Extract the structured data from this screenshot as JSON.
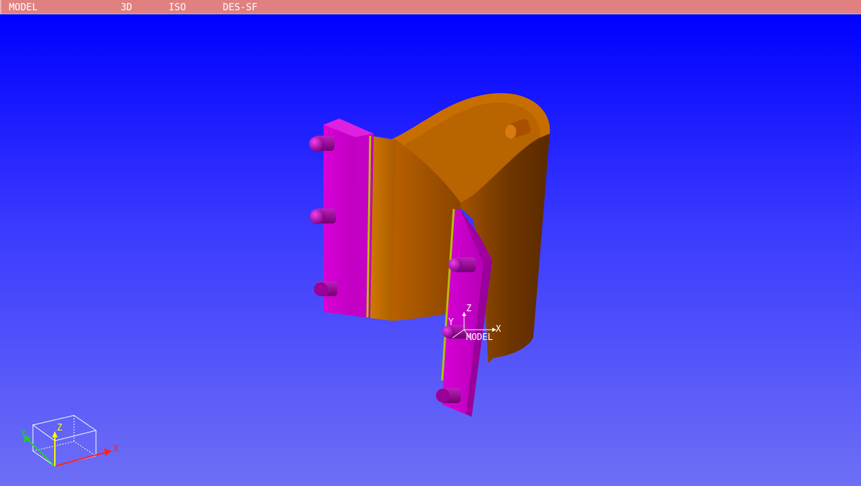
{
  "status_bar": {
    "mode": "MODEL",
    "view_dim": "3D",
    "projection": "ISO",
    "display": "DES-SF"
  },
  "model_axis": {
    "x": "X",
    "y": "Y",
    "z": "Z",
    "label": "MODEL"
  },
  "view_triad": {
    "x": "X",
    "y": "Y",
    "z": "Z"
  },
  "colors": {
    "status_bar": "#e08080",
    "background_top": "#0000ff",
    "background_bottom": "#6e6ff5",
    "clamp_body": "#c06a00",
    "plate": "#cc00cc",
    "weld_seam": "#b8c000",
    "axis_x": "#ff2020",
    "axis_y": "#20d020",
    "axis_z": "#ffff00"
  }
}
